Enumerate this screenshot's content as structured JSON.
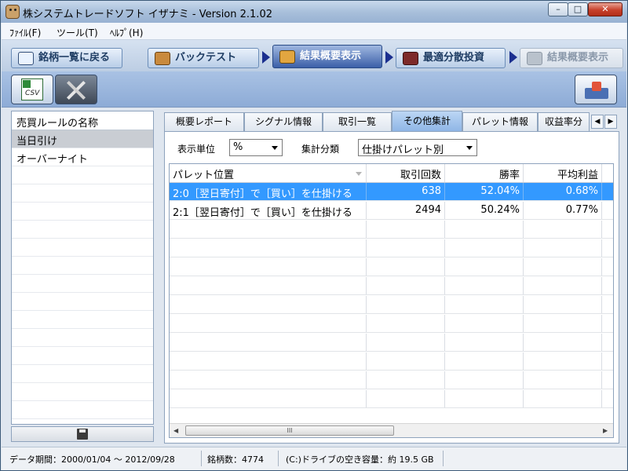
{
  "window": {
    "title": "株システムトレードソフト イザナミ - Version 2.1.02",
    "controls": {
      "minimize": "–",
      "maximize": "□",
      "close": "✕"
    }
  },
  "menu": [
    "ﾌｧｲﾙ(F)",
    "ツール(T)",
    "ﾍﾙﾌﾟ(H)"
  ],
  "nav": [
    {
      "label": "銘柄一覧に戻る",
      "icon": "eye-icon"
    },
    {
      "label": "バックテスト",
      "icon": "bag-icon"
    },
    {
      "label": "結果概要表示",
      "icon": "chart-hand-icon",
      "state": "active"
    },
    {
      "label": "最適分散投資",
      "icon": "calculator-icon"
    },
    {
      "label": "結果概要表示",
      "icon": "factory-icon",
      "state": "disabled"
    }
  ],
  "toolbar": {
    "csv_button_text": "CSV",
    "settings_icon": "tools-icon",
    "right_icon": "inbox-icon"
  },
  "rules": {
    "header": "売買ルールの名称",
    "items": [
      "当日引け",
      "オーバーナイト"
    ]
  },
  "tabs": [
    {
      "label": "概要レポート"
    },
    {
      "label": "シグナル情報"
    },
    {
      "label": "取引一覧"
    },
    {
      "label": "その他集計",
      "active": true
    },
    {
      "label": "パレット情報"
    },
    {
      "label": "収益率分"
    }
  ],
  "filters": {
    "unit_label": "表示単位",
    "unit_value": "%",
    "category_label": "集計分類",
    "category_value": "仕掛けパレット別"
  },
  "grid": {
    "columns": [
      "パレット位置",
      "取引回数",
      "勝率",
      "平均利益"
    ],
    "rows": [
      [
        "2:0［翌日寄付］で［買い］を仕掛ける",
        "638",
        "52.04%",
        "0.68%"
      ],
      [
        "2:1［翌日寄付］で［買い］を仕掛ける",
        "2494",
        "50.24%",
        "0.77%"
      ]
    ],
    "selected_row": 0,
    "scroll_thumb_text": "III"
  },
  "status": {
    "period": "データ期間：2000/01/04 〜 2012/09/28",
    "count": "銘柄数：4774",
    "disk": "(C:)ドライブの空き容量：約 19.5 GB"
  }
}
